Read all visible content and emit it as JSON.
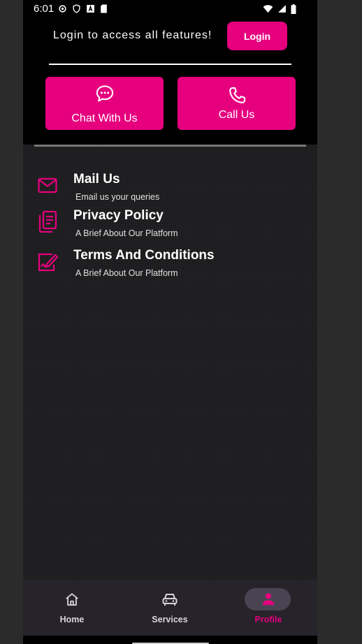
{
  "status_bar": {
    "time": "6:01"
  },
  "header": {
    "login_prompt": "Login to access all features!",
    "login_button": "Login"
  },
  "actions": {
    "chat_label": "Chat With Us",
    "call_label": "Call Us"
  },
  "menu": [
    {
      "title": "Mail Us",
      "subtitle": "Email us your queries",
      "icon": "mail-icon"
    },
    {
      "title": "Privacy Policy",
      "subtitle": "A Brief About Our Platform",
      "icon": "document-icon"
    },
    {
      "title": "Terms And Conditions",
      "subtitle": "A Brief About Our Platform",
      "icon": "signature-icon"
    }
  ],
  "bottom_nav": {
    "items": [
      {
        "label": "Home",
        "icon": "home-icon",
        "active": false
      },
      {
        "label": "Services",
        "icon": "car-icon",
        "active": false
      },
      {
        "label": "Profile",
        "icon": "person-icon",
        "active": true
      }
    ]
  },
  "colors": {
    "accent": "#e6007e",
    "background": "#1c1c1e",
    "header_background": "#000000",
    "nav_background": "#27232b"
  }
}
